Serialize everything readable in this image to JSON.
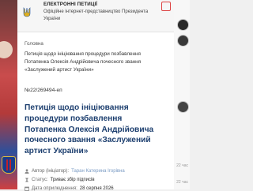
{
  "header": {
    "org_name": "ЕЛЕКТРОННІ ПЕТИЦІЇ",
    "org_description": "Офіційне інтернет-представництво Президента України"
  },
  "breadcrumb": {
    "home": "Головна",
    "current": "Петиція щодо ініціювання процедури позбавлення Потапенка Олексія Андрійовича почесного звання «Заслужений артист України»"
  },
  "petition": {
    "number": "№22/269494-еп",
    "title": "Петиція щодо ініціювання процедури позбавлення Потапенка Олексія Андрійовича почесного звання «Заслужений артист України»",
    "author_label": "Автор (ініціатор):",
    "author_value": "Таран Катерина Ігорівна",
    "status_label": "Статус:",
    "status_value": "Триває збір підписів",
    "date_label": "Дата оприлюднення:",
    "date_value": "28 серпня 2026"
  },
  "background": {
    "time_1": "22 час",
    "time_2": "22 час"
  },
  "colors": {
    "title": "#1d3f6f",
    "link": "#7a9bc4",
    "close_border": "#dd4444"
  },
  "icons": {
    "emblem": "trident-emblem-icon",
    "close": "close-icon",
    "author": "user-icon",
    "status": "hourglass-icon",
    "date": "calendar-icon"
  }
}
